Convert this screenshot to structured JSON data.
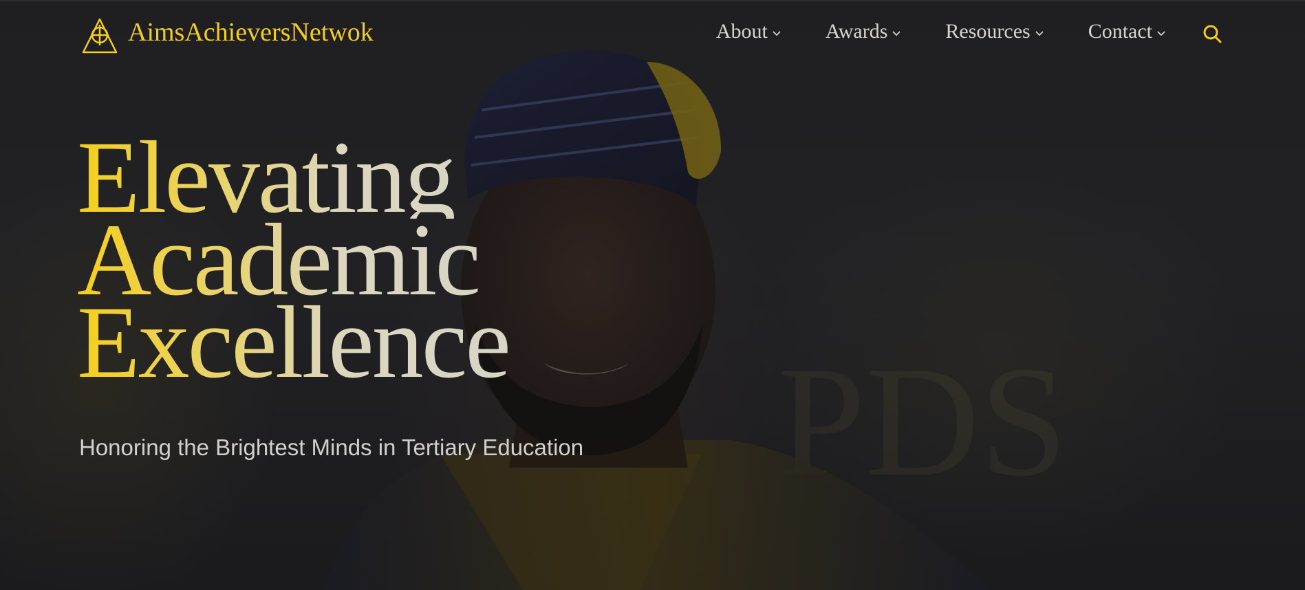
{
  "nav": {
    "brand_name": "AimsAchieversNetwok",
    "menu": [
      {
        "label": "About"
      },
      {
        "label": "Awards"
      },
      {
        "label": "Resources"
      },
      {
        "label": "Contact"
      }
    ]
  },
  "hero": {
    "headline_lines": [
      "Elevating",
      "Academic",
      "Excellence"
    ],
    "subtitle": "Honoring the Brightest Minds in Tertiary Education"
  },
  "colors": {
    "accent": "#f3cd21",
    "nav_text": "#d6d4cf",
    "background": "#232326"
  },
  "icons": {
    "logo": "triangle-circle-cross-logo",
    "chevron": "chevron-down-icon",
    "search": "search-icon"
  }
}
